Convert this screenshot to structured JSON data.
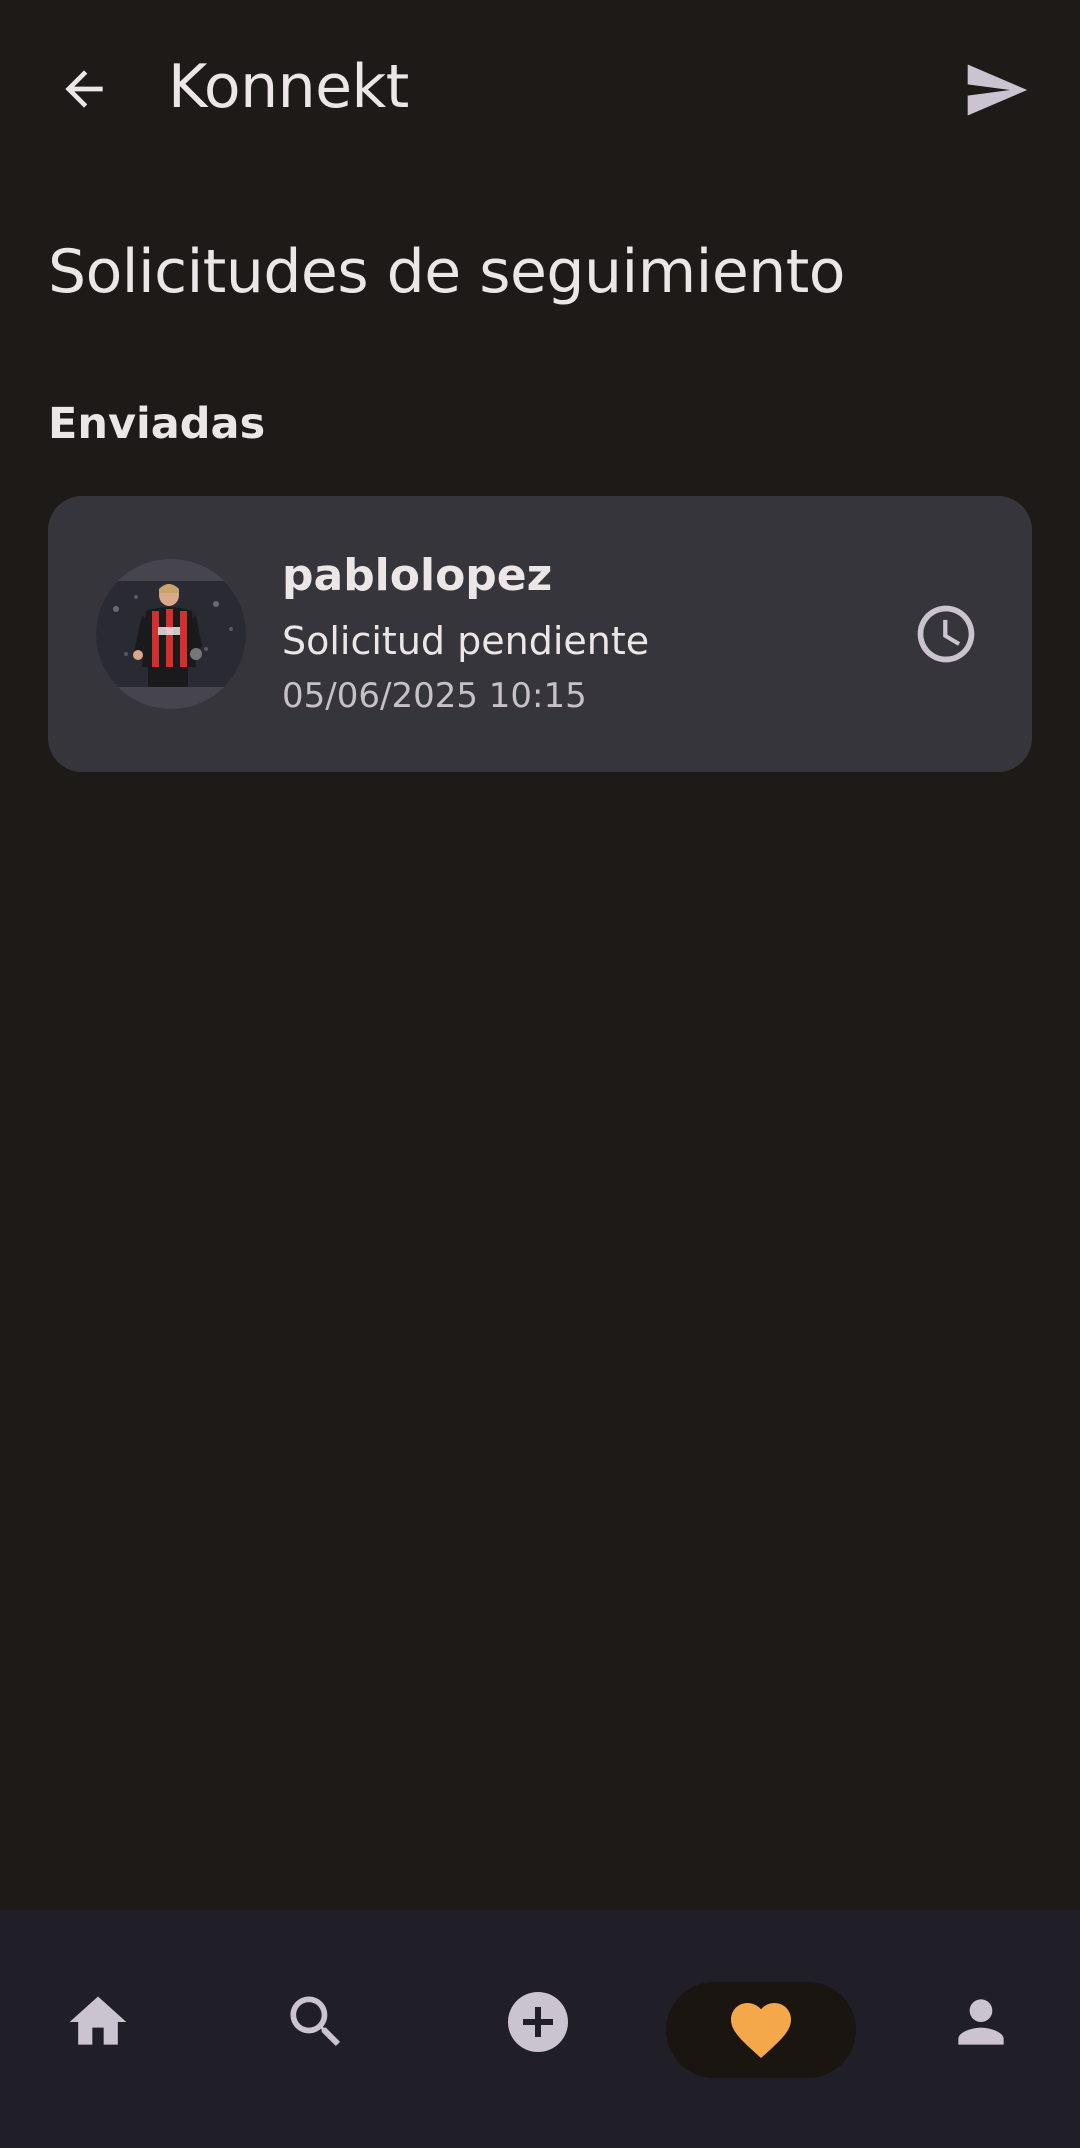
{
  "app_bar": {
    "title": "Konnekt",
    "back_icon": "arrow-back-icon",
    "send_icon": "send-icon"
  },
  "page": {
    "title": "Solicitudes de seguimiento"
  },
  "sections": [
    {
      "title": "Enviadas",
      "requests": [
        {
          "username": "pablolopez",
          "status": "Solicitud pendiente",
          "timestamp": "05/06/2025 10:15",
          "status_icon": "clock-icon"
        }
      ]
    }
  ],
  "bottom_nav": {
    "items": [
      {
        "icon": "home-icon",
        "active": false
      },
      {
        "icon": "search-icon",
        "active": false
      },
      {
        "icon": "add-circle-icon",
        "active": false
      },
      {
        "icon": "heart-icon",
        "active": true
      },
      {
        "icon": "person-icon",
        "active": false
      }
    ]
  },
  "colors": {
    "background": "#1e1a18",
    "card": "#36353c",
    "nav_background": "#201f27",
    "accent": "#f5a84a",
    "text": "#ece6e6",
    "icon": "#cbc4d0"
  }
}
